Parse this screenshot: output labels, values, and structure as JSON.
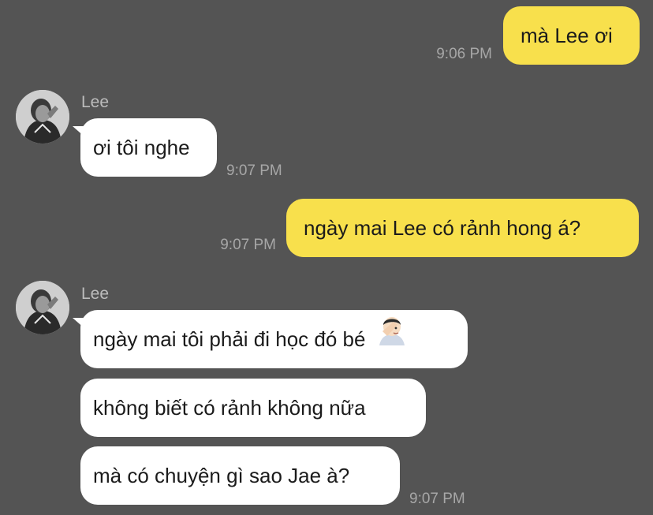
{
  "conversation": {
    "messages": [
      {
        "sender": "me",
        "text": "mà Lee ơi",
        "time": "9:06 PM"
      },
      {
        "sender": "Lee",
        "text": "ơi tôi nghe",
        "time": "9:07 PM"
      },
      {
        "sender": "me",
        "text": "ngày mai Lee có rảnh hong á?",
        "time": "9:07 PM"
      },
      {
        "sender": "Lee",
        "text": "ngày mai tôi phải đi học đó bé",
        "emoji": "face-palm-emoji"
      },
      {
        "sender": "Lee",
        "text": "không biết có rảnh không nữa"
      },
      {
        "sender": "Lee",
        "text": "mà có chuyện gì sao Jae à?",
        "time": "9:07 PM"
      }
    ],
    "contact": {
      "name": "Lee"
    }
  },
  "colors": {
    "background": "#545454",
    "my_bubble": "#f8e04c",
    "their_bubble": "#ffffff",
    "timestamp": "#a7a7a7"
  }
}
